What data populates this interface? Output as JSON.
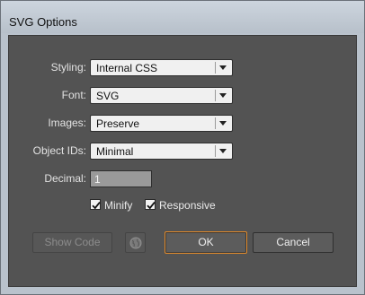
{
  "window": {
    "title": "SVG Options"
  },
  "fields": {
    "styling": {
      "label": "Styling:",
      "value": "Internal CSS"
    },
    "font": {
      "label": "Font:",
      "value": "SVG"
    },
    "images": {
      "label": "Images:",
      "value": "Preserve"
    },
    "object_ids": {
      "label": "Object IDs:",
      "value": "Minimal"
    },
    "decimal": {
      "label": "Decimal:",
      "value": "1"
    }
  },
  "checkboxes": {
    "minify": {
      "label": "Minify",
      "checked": true
    },
    "responsive": {
      "label": "Responsive",
      "checked": true
    }
  },
  "buttons": {
    "show_code": "Show Code",
    "ok": "OK",
    "cancel": "Cancel"
  },
  "icons": {
    "web": "globe-icon",
    "dropdown": "chevron-down-icon",
    "check": "checkmark-icon"
  },
  "colors": {
    "panel_bg": "#535353",
    "frame_bg": "#b9c2cc",
    "default_button_border": "#e08a2c"
  }
}
